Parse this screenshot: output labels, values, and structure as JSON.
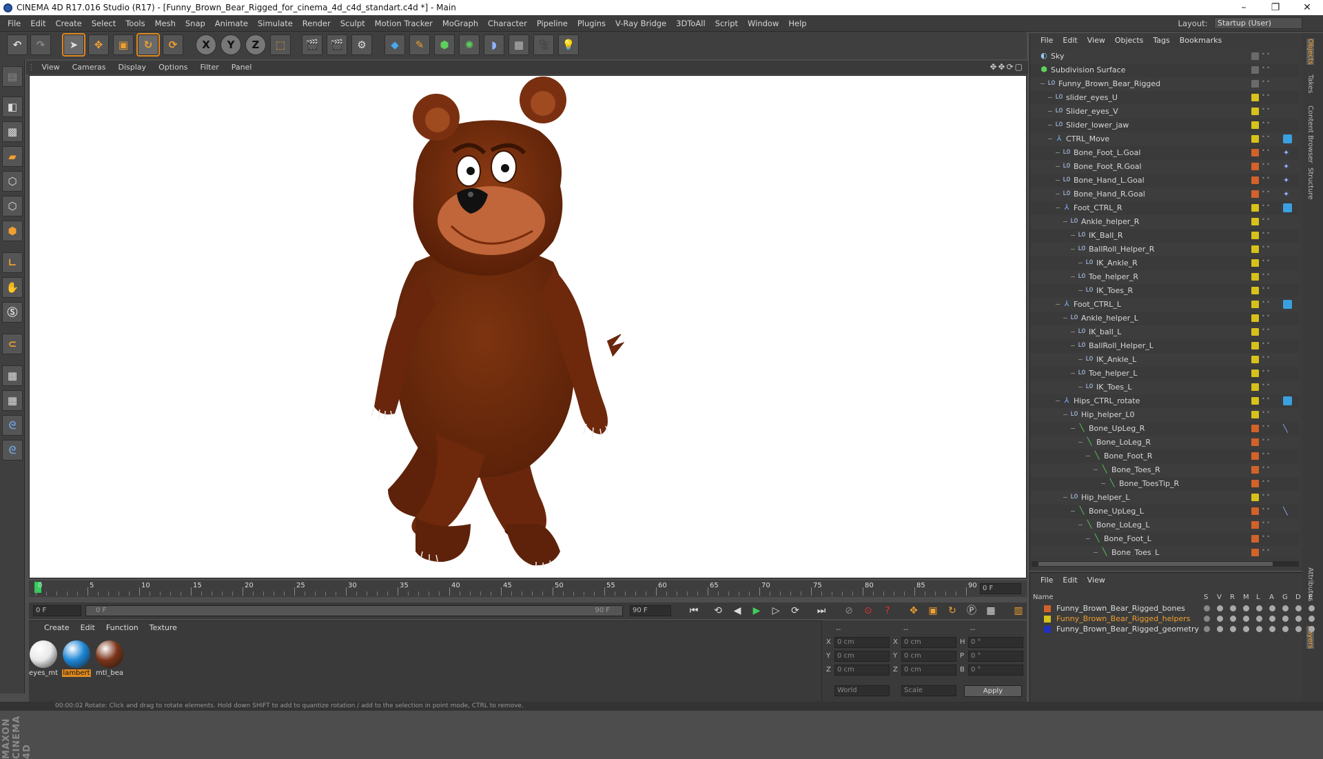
{
  "window": {
    "title": "CINEMA 4D R17.016 Studio (R17) - [Funny_Brown_Bear_Rigged_for_cinema_4d_c4d_standart.c4d *] - Main",
    "controls": [
      "–",
      "❐",
      "✕"
    ]
  },
  "menubar": {
    "items": [
      "File",
      "Edit",
      "Create",
      "Select",
      "Tools",
      "Mesh",
      "Snap",
      "Animate",
      "Simulate",
      "Render",
      "Sculpt",
      "Motion Tracker",
      "MoGraph",
      "Character",
      "Pipeline",
      "Plugins",
      "V-Ray Bridge",
      "3DToAll",
      "Script",
      "Window",
      "Help"
    ],
    "layout_label": "Layout:",
    "layout_value": "Startup (User)"
  },
  "toolbar": {
    "axis_x": "X",
    "axis_y": "Y",
    "axis_z": "Z"
  },
  "viewport": {
    "menu": [
      "View",
      "Cameras",
      "Display",
      "Options",
      "Filter",
      "Panel"
    ]
  },
  "timeline": {
    "ticks": [
      "0",
      "5",
      "10",
      "15",
      "20",
      "25",
      "30",
      "35",
      "40",
      "45",
      "50",
      "55",
      "60",
      "65",
      "70",
      "75",
      "80",
      "85",
      "90"
    ],
    "current_frame": "0 F",
    "start_field": "0 F",
    "range_start": "0 F",
    "range_end": "90 F",
    "end_field": "90 F"
  },
  "materials": {
    "menu": [
      "Create",
      "Edit",
      "Function",
      "Texture"
    ],
    "items": [
      {
        "name": "eyes_mt",
        "color": "#e8e8e8"
      },
      {
        "name": "lambert",
        "color": "#1e86d6"
      },
      {
        "name": "mtl_bea",
        "color": "#7a3418"
      }
    ]
  },
  "attributes": {
    "header": [
      "--",
      "--",
      "--"
    ],
    "rows": [
      {
        "a": "X",
        "av": "0 cm",
        "b": "X",
        "bv": "0 cm",
        "c": "H",
        "cv": "0 °"
      },
      {
        "a": "Y",
        "av": "0 cm",
        "b": "Y",
        "bv": "0 cm",
        "c": "P",
        "cv": "0 °"
      },
      {
        "a": "Z",
        "av": "0 cm",
        "b": "Z",
        "bv": "0 cm",
        "c": "B",
        "cv": "0 °"
      }
    ],
    "world": "World",
    "scale": "Scale",
    "apply": "Apply"
  },
  "objects": {
    "menu": [
      "File",
      "Edit",
      "View",
      "Objects",
      "Tags",
      "Bookmarks"
    ],
    "rows": [
      {
        "name": "Sky",
        "indent": 0,
        "icon": "sky",
        "tag": "#6a6a6a"
      },
      {
        "name": "Subdivision Surface",
        "indent": 0,
        "icon": "subdiv",
        "tag": "#6a6a6a"
      },
      {
        "name": "Funny_Brown_Bear_Rigged",
        "indent": 1,
        "icon": "null",
        "tag": "#6a6a6a"
      },
      {
        "name": "slider_eyes_U",
        "indent": 2,
        "icon": "null",
        "tag": "#d6c21a"
      },
      {
        "name": "Slider_eyes_V",
        "indent": 2,
        "icon": "null",
        "tag": "#d6c21a"
      },
      {
        "name": "Slider_lower_jaw",
        "indent": 2,
        "icon": "null",
        "tag": "#d6c21a"
      },
      {
        "name": "CTRL_Move",
        "indent": 2,
        "icon": "joint",
        "tag": "#d6c21a"
      },
      {
        "name": "Bone_Foot_L.Goal",
        "indent": 3,
        "icon": "null",
        "tag": "#d2622a"
      },
      {
        "name": "Bone_Foot_R.Goal",
        "indent": 3,
        "icon": "null",
        "tag": "#d2622a"
      },
      {
        "name": "Bone_Hand_L.Goal",
        "indent": 3,
        "icon": "null",
        "tag": "#d2622a"
      },
      {
        "name": "Bone_Hand_R.Goal",
        "indent": 3,
        "icon": "null",
        "tag": "#d2622a"
      },
      {
        "name": "Foot_CTRL_R",
        "indent": 3,
        "icon": "joint",
        "tag": "#d6c21a"
      },
      {
        "name": "Ankle_helper_R",
        "indent": 4,
        "icon": "null",
        "tag": "#d6c21a"
      },
      {
        "name": "IK_Ball_R",
        "indent": 5,
        "icon": "null",
        "tag": "#d6c21a"
      },
      {
        "name": "BallRoll_Helper_R",
        "indent": 5,
        "icon": "null",
        "tag": "#d6c21a"
      },
      {
        "name": "IK_Ankle_R",
        "indent": 6,
        "icon": "null",
        "tag": "#d6c21a"
      },
      {
        "name": "Toe_helper_R",
        "indent": 5,
        "icon": "null",
        "tag": "#d6c21a"
      },
      {
        "name": "IK_Toes_R",
        "indent": 6,
        "icon": "null",
        "tag": "#d6c21a"
      },
      {
        "name": "Foot_CTRL_L",
        "indent": 3,
        "icon": "joint",
        "tag": "#d6c21a"
      },
      {
        "name": "Ankle_helper_L",
        "indent": 4,
        "icon": "null",
        "tag": "#d6c21a"
      },
      {
        "name": "IK_ball_L",
        "indent": 5,
        "icon": "null",
        "tag": "#d6c21a"
      },
      {
        "name": "BallRoll_Helper_L",
        "indent": 5,
        "icon": "null",
        "tag": "#d6c21a"
      },
      {
        "name": "IK_Ankle_L",
        "indent": 6,
        "icon": "null",
        "tag": "#d6c21a"
      },
      {
        "name": "Toe_helper_L",
        "indent": 5,
        "icon": "null",
        "tag": "#d6c21a"
      },
      {
        "name": "IK_Toes_L",
        "indent": 6,
        "icon": "null",
        "tag": "#d6c21a"
      },
      {
        "name": "Hips_CTRL_rotate",
        "indent": 3,
        "icon": "joint",
        "tag": "#d6c21a"
      },
      {
        "name": "Hip_helper_L0",
        "indent": 4,
        "icon": "null",
        "tag": "#d6c21a"
      },
      {
        "name": "Bone_UpLeg_R",
        "indent": 5,
        "icon": "bone",
        "tag": "#d2622a"
      },
      {
        "name": "Bone_LoLeg_R",
        "indent": 6,
        "icon": "bone",
        "tag": "#d2622a"
      },
      {
        "name": "Bone_Foot_R",
        "indent": 7,
        "icon": "bone",
        "tag": "#d2622a"
      },
      {
        "name": "Bone_Toes_R",
        "indent": 8,
        "icon": "bone",
        "tag": "#d2622a"
      },
      {
        "name": "Bone_ToesTip_R",
        "indent": 9,
        "icon": "bone",
        "tag": "#d2622a"
      },
      {
        "name": "Hip_helper_L",
        "indent": 4,
        "icon": "null",
        "tag": "#d6c21a"
      },
      {
        "name": "Bone_UpLeg_L",
        "indent": 5,
        "icon": "bone",
        "tag": "#d2622a"
      },
      {
        "name": "Bone_LoLeg_L",
        "indent": 6,
        "icon": "bone",
        "tag": "#d2622a"
      },
      {
        "name": "Bone_Foot_L",
        "indent": 7,
        "icon": "bone",
        "tag": "#d2622a"
      },
      {
        "name": "Bone_Toes_L",
        "indent": 8,
        "icon": "bone",
        "tag": "#d2622a"
      }
    ]
  },
  "right_tabs": [
    "Objects",
    "Takes",
    "Content Browser",
    "Structure",
    "Attributes",
    "Layers"
  ],
  "layers": {
    "menu": [
      "File",
      "Edit",
      "View"
    ],
    "name_header": "Name",
    "columns": [
      "S",
      "V",
      "R",
      "M",
      "L",
      "A",
      "G",
      "D",
      "E"
    ],
    "rows": [
      {
        "name": "Funny_Brown_Bear_Rigged_bones",
        "color": "#d2622a",
        "highlight": false
      },
      {
        "name": "Funny_Brown_Bear_Rigged_helpers",
        "color": "#d6c21a",
        "highlight": true
      },
      {
        "name": "Funny_Brown_Bear_Rigged_geometry",
        "color": "#2030c0",
        "highlight": false
      }
    ]
  },
  "status": {
    "text": "00:00:02   Rotate: Click and drag to rotate elements. Hold down SHIFT to add to quantize rotation / add to the selection in point mode, CTRL to remove."
  },
  "colors": {
    "accent": "#e08a20",
    "viewport_bg": "#ffffff",
    "panel_bg": "#3c3c3c"
  }
}
